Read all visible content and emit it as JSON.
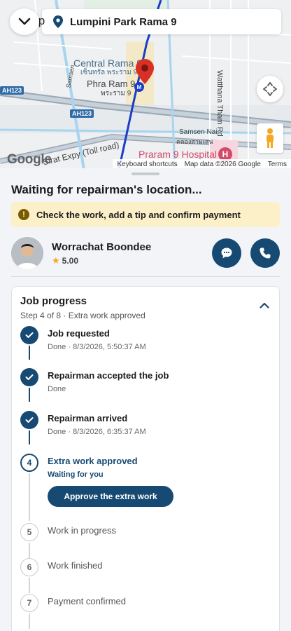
{
  "map": {
    "location_label": "Lumpini Park Rama 9",
    "partial_label": "ıp",
    "labels": {
      "central_rama9_en": "Central Rama 9",
      "central_rama9_th": "เซ็นทรัล พระราม 9",
      "phra_ram9_en": "Phra Ram 9",
      "phra_ram9_th": "พระราม 9",
      "samsen": "Samsen",
      "wattana": "Watthana Tham Rd",
      "samsen_nai_en": "Samsen Nai",
      "samsen_nai_th": "คลองสามเสน",
      "hospital": "Praram 9 Hospital",
      "sirat": "Sirat Expy (Toll road)",
      "ah123_left": "AH123",
      "ah123_mid": "AH123"
    },
    "google_logo": "Google",
    "attribution": {
      "shortcuts": "Keyboard shortcuts",
      "map_data": "Map data ©2026 Google",
      "terms": "Terms"
    }
  },
  "sheet": {
    "title": "Waiting for repairman's location...",
    "notice": "Check the work, add a tip and confirm payment"
  },
  "repairman": {
    "name": "Worrachat Boondee",
    "rating": "5.00"
  },
  "job_progress": {
    "title": "Job progress",
    "subtitle": "Step 4 of 8 · Extra work approved",
    "approve_label": "Approve the extra work",
    "steps": [
      {
        "number": "1",
        "title": "Job requested",
        "meta": "Done · 8/3/2026, 5:50:37 AM",
        "state": "done"
      },
      {
        "number": "2",
        "title": "Repairman accepted the job",
        "meta": "Done",
        "state": "done"
      },
      {
        "number": "3",
        "title": "Repairman arrived",
        "meta": "Done · 8/3/2026, 6:35:37 AM",
        "state": "done"
      },
      {
        "number": "4",
        "title": "Extra work approved",
        "meta": "Waiting for you",
        "state": "current"
      },
      {
        "number": "5",
        "title": "Work in progress",
        "meta": "",
        "state": "pending"
      },
      {
        "number": "6",
        "title": "Work finished",
        "meta": "",
        "state": "pending"
      },
      {
        "number": "7",
        "title": "Payment confirmed",
        "meta": "",
        "state": "pending"
      }
    ]
  },
  "colors": {
    "primary": "#174a73",
    "notice_bg": "#fbf0c8",
    "pin_red": "#d93025"
  }
}
